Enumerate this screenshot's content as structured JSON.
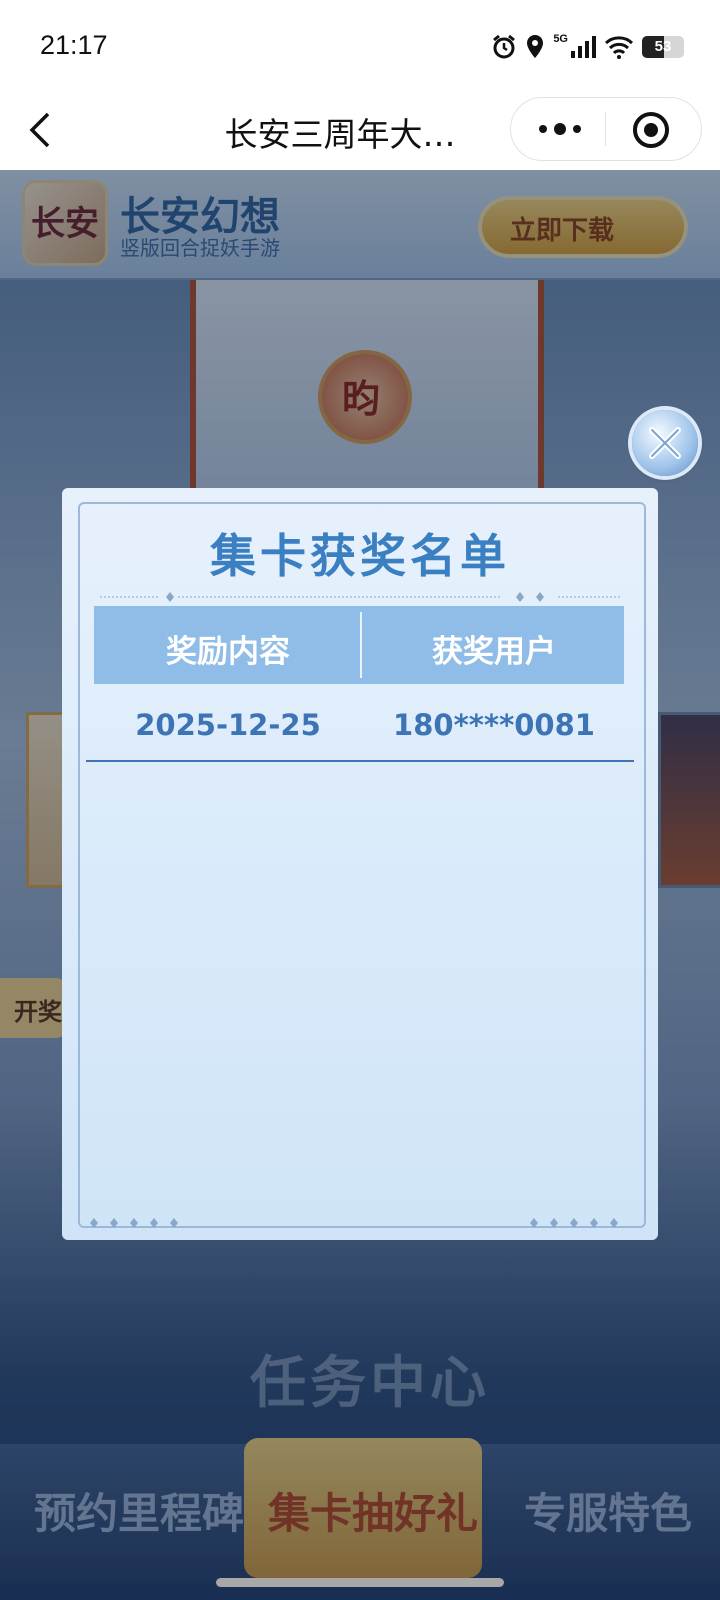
{
  "status_bar": {
    "time": "21:17",
    "battery": "53",
    "network": "5G"
  },
  "title_bar": {
    "title": "长安三周年大…"
  },
  "game": {
    "logo_text": "长安",
    "name": "长安幻想",
    "subtitle": "竖版回合捉妖手游",
    "download_label": "立即下载",
    "card_seal": "昀",
    "open_tag": "开奖",
    "task_center": "任务中心",
    "nav": {
      "left": "预约里程碑",
      "center": "集卡抽好礼",
      "right": "专服特色"
    }
  },
  "dialog": {
    "title": "集卡获奖名单",
    "headers": [
      "奖励内容",
      "获奖用户"
    ],
    "rows": [
      {
        "reward": "2025-12-25",
        "user": "180****0081"
      }
    ]
  }
}
